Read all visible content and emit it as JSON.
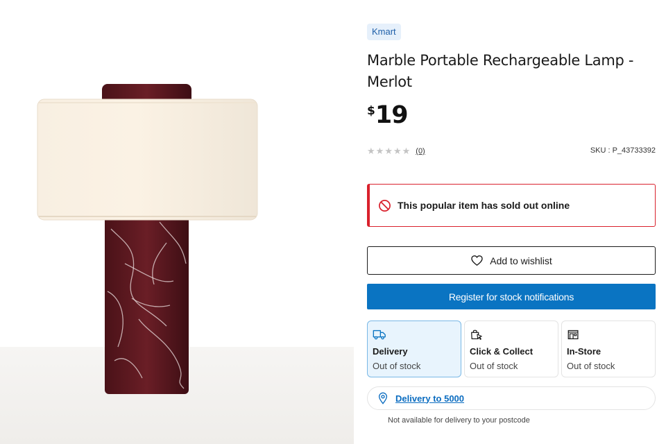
{
  "product": {
    "brand": "Kmart",
    "title": "Marble Portable Rechargeable Lamp - Merlot",
    "price_currency": "$",
    "price_amount": "19",
    "rating_stars": 0,
    "rating_count": "(0)",
    "sku": "SKU : P_43733392",
    "image_icon": "lamp-product-photo"
  },
  "alert": {
    "icon": "prohibited-icon",
    "text": "This popular item has sold out online",
    "color": "#d9202c"
  },
  "actions": {
    "wishlist_label": "Add to wishlist",
    "notify_label": "Register for stock notifications",
    "notify_color": "#0a74c2"
  },
  "fulfilment": [
    {
      "name": "Delivery",
      "status": "Out of stock",
      "icon": "truck-icon",
      "selected": true
    },
    {
      "name": "Click & Collect",
      "status": "Out of stock",
      "icon": "bag-cursor-icon",
      "selected": false
    },
    {
      "name": "In-Store",
      "status": "Out of stock",
      "icon": "store-icon",
      "selected": false
    }
  ],
  "delivery": {
    "link_text": "Delivery to 5000",
    "note": "Not available for delivery to your postcode"
  }
}
